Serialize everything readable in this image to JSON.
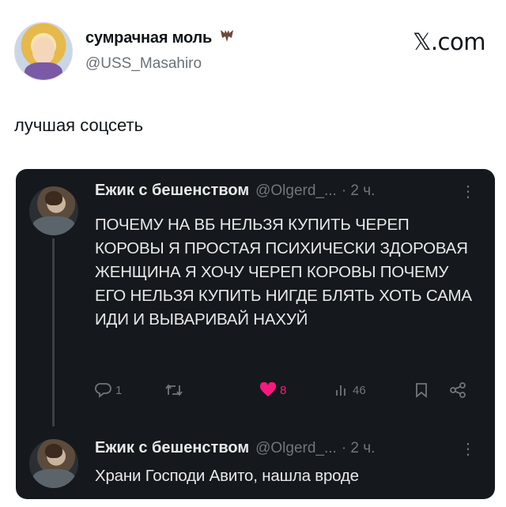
{
  "outer": {
    "name": "сумрачная моль",
    "name_icon": "bat-icon",
    "handle": "@USS_Masahiro",
    "brand": "𝕏.com",
    "text": "лучшая соцсеть"
  },
  "tweets": [
    {
      "name": "Ежик с бешенством",
      "handle": "@Olgerd_...",
      "time": "· 2 ч.",
      "more": "⋮",
      "text": "ПОЧЕМУ НА ВБ НЕЛЬЗЯ КУПИТЬ ЧЕРЕП КОРОВЫ Я ПРОСТАЯ ПСИХИЧЕСКИ ЗДОРОВАЯ ЖЕНЩИНА Я ХОЧУ ЧЕРЕП КОРОВЫ ПОЧЕМУ ЕГО НЕЛЬЗЯ КУПИТЬ НИГДЕ БЛЯТЬ ХОТЬ САМА ИДИ И ВЫВАРИВАЙ НАХУЙ",
      "actions": {
        "replies": "1",
        "retweets": "",
        "likes": "8",
        "views": "46"
      }
    },
    {
      "name": "Ежик с бешенством",
      "handle": "@Olgerd_...",
      "time": "· 2 ч.",
      "more": "⋮",
      "text": "Храни Господи Авито, нашла вроде"
    }
  ],
  "colors": {
    "card_bg": "#15181c",
    "like": "#f91880",
    "muted": "#71767b"
  }
}
